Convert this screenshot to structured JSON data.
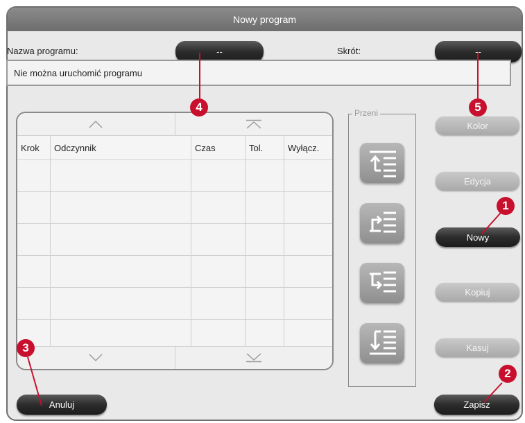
{
  "window": {
    "title": "Nowy program"
  },
  "fields": {
    "name_label": "Nazwa programu:",
    "name_value": "--",
    "short_label": "Skrót:",
    "short_value": "--"
  },
  "status_message": "Nie można uruchomić programu",
  "table": {
    "columns": [
      "Krok",
      "Odczynnik",
      "Czas",
      "Tol.",
      "Wyłącz."
    ],
    "rows": []
  },
  "move_panel": {
    "title": "Przeni"
  },
  "side_buttons": {
    "color": "Kolor",
    "edit": "Edycja",
    "new": "Nowy",
    "copy": "Kopiuj",
    "delete": "Kasuj"
  },
  "footer": {
    "cancel": "Anuluj",
    "save": "Zapisz"
  },
  "callouts": [
    "1",
    "2",
    "3",
    "4",
    "5"
  ],
  "colors": {
    "callout": "#c8102e",
    "title_bar": "#7a7a7a",
    "dark_button": "#2a2a2a"
  },
  "icons": [
    "scroll-up-icon",
    "scroll-top-icon",
    "scroll-down-icon",
    "scroll-bottom-icon",
    "move-to-top-icon",
    "move-up-icon",
    "move-down-icon",
    "move-to-bottom-icon"
  ]
}
